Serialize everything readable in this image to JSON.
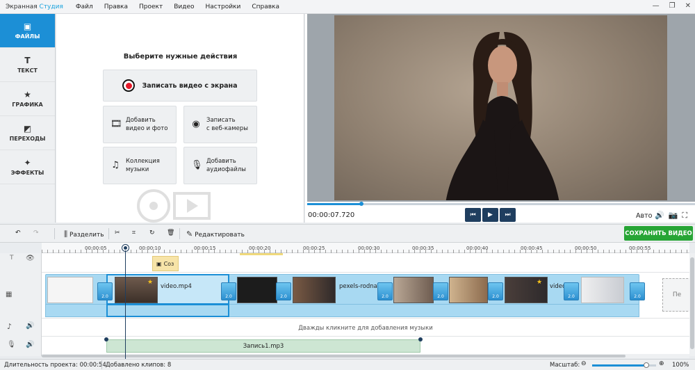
{
  "app": {
    "brand_main": "Экранная",
    "brand_accent": "Студия",
    "accent_color": "#1c8fd6"
  },
  "menu": [
    "Файл",
    "Правка",
    "Проект",
    "Видео",
    "Настройки",
    "Справка"
  ],
  "window_controls": {
    "minimize": "—",
    "restore": "❐",
    "close": "✕"
  },
  "sidebar": {
    "items": [
      {
        "label": "ФАЙЛЫ",
        "icon": "folder-icon",
        "glyph": "▣",
        "active": true
      },
      {
        "label": "ТЕКСТ",
        "icon": "text-icon",
        "glyph": "T",
        "active": false
      },
      {
        "label": "ГРАФИКА",
        "icon": "star-icon",
        "glyph": "★",
        "active": false
      },
      {
        "label": "ПЕРЕХОДЫ",
        "icon": "transitions-icon",
        "glyph": "◩",
        "active": false
      },
      {
        "label": "ЭФФЕКТЫ",
        "icon": "magic-wand-icon",
        "glyph": "✦",
        "active": false
      }
    ]
  },
  "actions": {
    "title": "Выберите нужные действия",
    "record": "Записать видео с экрана",
    "add_video_1": "Добавить",
    "add_video_2": "видео и фото",
    "webcam_1": "Записать",
    "webcam_2": "с веб-камеры",
    "music_1": "Коллекция",
    "music_2": "музыки",
    "audio_1": "Добавить",
    "audio_2": "аудиофайлы"
  },
  "player": {
    "timecode": "00:00:07.720",
    "progress": 0.14,
    "auto": "Авто"
  },
  "toolbar": {
    "split": "Разделить",
    "edit": "Редактировать",
    "save": "СОХРАНИТЬ ВИДЕО",
    "save_color": "#27a535"
  },
  "ruler": [
    "00:00:05",
    "00:00:10",
    "00:00:15",
    "00:00:20",
    "00:00:25",
    "00:00:30",
    "00:00:35",
    "00:00:40",
    "00:00:45",
    "00:00:50",
    "00:00:55"
  ],
  "timeline": {
    "text_clip": "Соз",
    "video_label_1": "video.mp4",
    "video_label_2": "pexels-rodnae-",
    "video_label_3": "videc",
    "transition": "2.0",
    "placeholder": "Пе",
    "music_hint": "Дважды кликните для добавления музыки",
    "audio_clip": "Запись1.mp3"
  },
  "status": {
    "duration_label": "Длительность проекта:",
    "duration": "00:00:54",
    "clips_label": "Добавлено клипов:",
    "clips": "8",
    "zoom_label": "Масштаб:",
    "zoom": "100%",
    "zoom_level": 0.85
  }
}
